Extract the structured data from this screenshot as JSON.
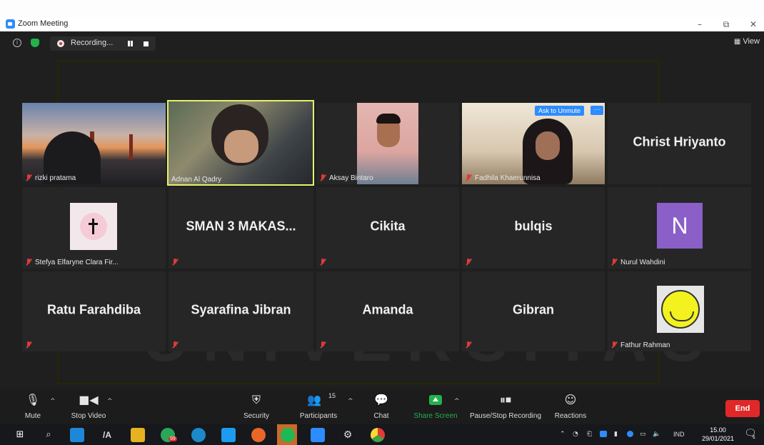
{
  "window": {
    "title": "Zoom Meeting",
    "minimize": "–",
    "restore": "⧉",
    "close": "✕"
  },
  "topbar": {
    "recording_label": "Recording...",
    "view_label": "View"
  },
  "background": {
    "watermark": "UNIVERSITAS"
  },
  "tiles": {
    "rizki": {
      "name": "rizki pratama"
    },
    "adnan": {
      "name": "Adnan Al Qadry"
    },
    "aksay": {
      "name": "Aksay Bintaro"
    },
    "fadhila": {
      "name": "Fadhila Khaerunnisa",
      "ask_to_unmute": "Ask to Unmute",
      "more": "···"
    },
    "christ": {
      "display": "Christ Hriyanto"
    },
    "stefya": {
      "name": "Stefya Elfaryne Clara Fir..."
    },
    "sman": {
      "display": "SMAN 3 MAKAS..."
    },
    "cikita": {
      "display": "Cikita"
    },
    "bulqis": {
      "display": "bulqis"
    },
    "nurul": {
      "name": "Nurul Wahdini",
      "initial": "N"
    },
    "ratu": {
      "display": "Ratu Farahdiba"
    },
    "syarafina": {
      "display": "Syarafina Jibran"
    },
    "amanda": {
      "display": "Amanda"
    },
    "gibran": {
      "display": "Gibran"
    },
    "fathur": {
      "name": "Fathur Rahman"
    }
  },
  "controls": {
    "mute": "Mute",
    "stop_video": "Stop Video",
    "security": "Security",
    "participants": "Participants",
    "participant_count": "15",
    "chat": "Chat",
    "share_screen": "Share Screen",
    "pause_stop_recording": "Pause/Stop Recording",
    "reactions": "Reactions",
    "end": "End"
  },
  "taskbar": {
    "badge_count": "99",
    "lang": "IND",
    "time": "15.00",
    "date": "29/01/2021",
    "notif_count": "1"
  },
  "colors": {
    "zoom_blue": "#2d8cff",
    "share_green": "#23b14d",
    "end_red": "#e02828",
    "active_speaker": "#e7f26b",
    "mute_red": "#e03a3a"
  }
}
